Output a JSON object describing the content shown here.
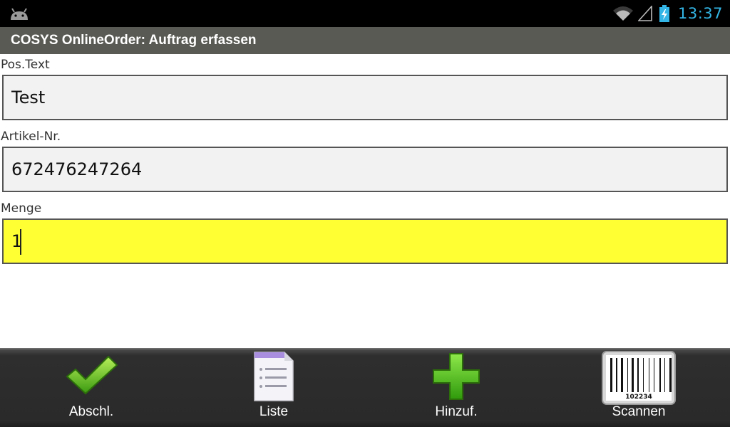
{
  "status_bar": {
    "time": "13:37",
    "icons": [
      "android-icon",
      "wifi-icon",
      "signal-icon",
      "battery-charging-icon"
    ],
    "accent_color": "#33b5e5"
  },
  "title_bar": {
    "title": "COSYS OnlineOrder: Auftrag erfassen"
  },
  "form": {
    "pos_text": {
      "label": "Pos.Text",
      "value": "Test"
    },
    "artikel_nr": {
      "label": "Artikel-Nr.",
      "value": "672476247264"
    },
    "menge": {
      "label": "Menge",
      "value": "1",
      "highlight_color": "#ffff33"
    }
  },
  "toolbar": {
    "buttons": [
      {
        "label": "Abschl.",
        "icon": "checkmark-icon"
      },
      {
        "label": "Liste",
        "icon": "list-document-icon"
      },
      {
        "label": "Hinzuf.",
        "icon": "plus-icon"
      },
      {
        "label": "Scannen",
        "icon": "barcode-icon",
        "barcode_number": "102234"
      }
    ]
  }
}
